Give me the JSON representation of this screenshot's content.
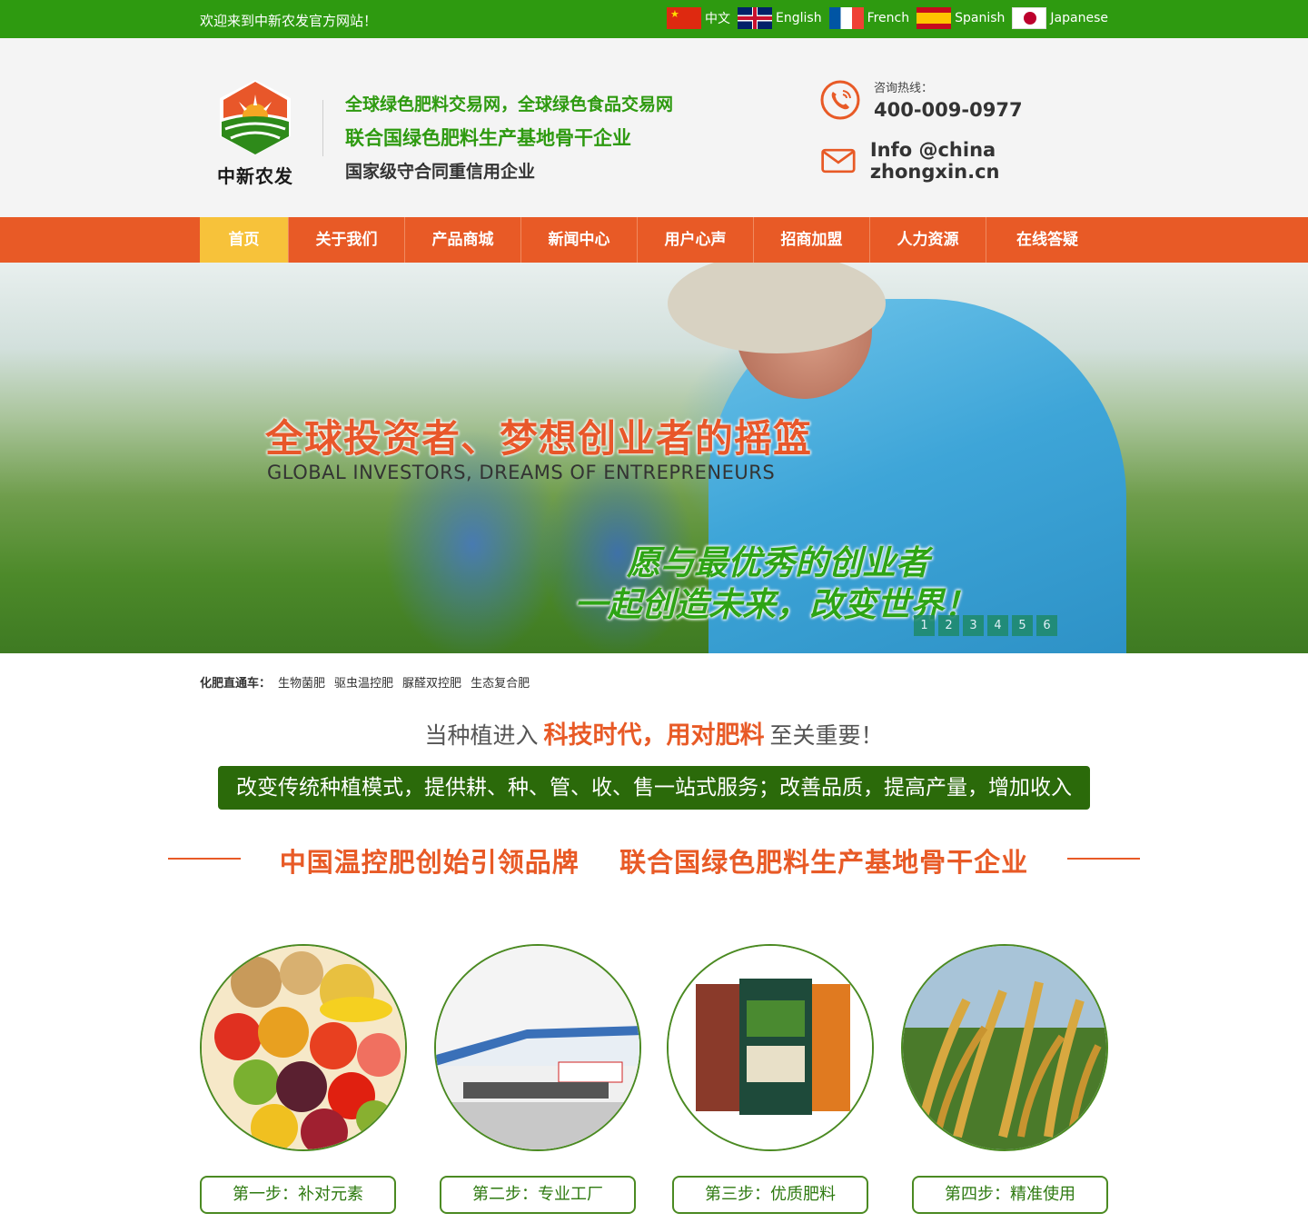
{
  "topbar": {
    "welcome": "欢迎来到中新农发官方网站！",
    "languages": [
      {
        "label": "中文",
        "icon": "china-flag-icon"
      },
      {
        "label": "English",
        "icon": "uk-flag-icon"
      },
      {
        "label": "French",
        "icon": "france-flag-icon"
      },
      {
        "label": "Spanish",
        "icon": "spain-flag-icon"
      },
      {
        "label": "Japanese",
        "icon": "japan-flag-icon"
      }
    ]
  },
  "header": {
    "logo_name": "中新农发",
    "slogan1": "全球绿色肥料交易网，全球绿色食品交易网",
    "slogan2": "联合国绿色肥料生产基地骨干企业",
    "slogan3": "国家级守合同重信用企业",
    "hotline_label": "咨询热线：",
    "hotline": "400-009-0977",
    "email": "Info @china zhongxin.cn"
  },
  "nav": {
    "items": [
      {
        "label": "首页",
        "active": true
      },
      {
        "label": "关于我们"
      },
      {
        "label": "产品商城"
      },
      {
        "label": "新闻中心"
      },
      {
        "label": "用户心声"
      },
      {
        "label": "招商加盟"
      },
      {
        "label": "人力资源"
      },
      {
        "label": "在线答疑"
      }
    ]
  },
  "banner": {
    "title": "全球投资者、梦想创业者的摇篮",
    "subtitle": "GLOBAL INVESTORS, DREAMS OF ENTREPRENEURS",
    "green_line1": "愿与最优秀的创业者",
    "green_line2": "一起创造未来，改变世界！",
    "pages": [
      "1",
      "2",
      "3",
      "4",
      "5",
      "6"
    ]
  },
  "quick": {
    "label": "化肥直通车：",
    "links": [
      "生物菌肥",
      "驱虫温控肥",
      "脲醛双控肥",
      "生态复合肥"
    ]
  },
  "headline": {
    "pre": "当种植进入",
    "highlight": "科技时代，用对肥料",
    "post": "至关重要！"
  },
  "greenbar": "改变传统种植模式，提供耕、种、管、收、售一站式服务；改善品质，提高产量，增加收入",
  "brandline": "中国温控肥创始引领品牌    联合国绿色肥料生产基地骨干企业",
  "steps": [
    {
      "label": "第一步：补对元素",
      "image": "fruits-vegetables"
    },
    {
      "label": "第二步：专业工厂",
      "image": "factory"
    },
    {
      "label": "第三步：优质肥料",
      "image": "fertilizer-bags"
    },
    {
      "label": "第四步：精准使用",
      "image": "rice-field"
    }
  ],
  "colors": {
    "green": "#2e9a10",
    "orange": "#e85a26",
    "yellow": "#f7c23a",
    "dark_green": "#2b6a0a"
  }
}
